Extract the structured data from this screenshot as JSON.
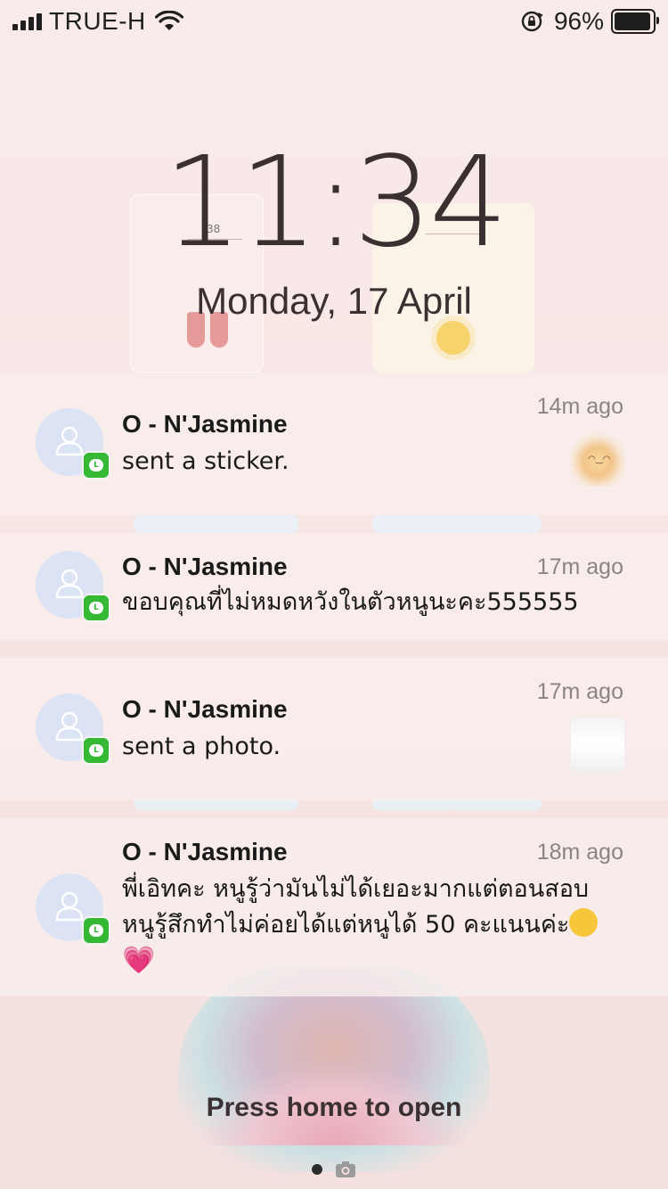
{
  "status_bar": {
    "carrier": "TRUE-H",
    "battery_percent": "96%",
    "battery_level": 0.96,
    "signal_icon": "signal-bars-icon",
    "wifi_icon": "wifi-icon",
    "orientation_lock_icon": "orientation-lock-icon",
    "battery_icon": "battery-icon"
  },
  "lock_screen": {
    "time": "11:34",
    "date": "Monday, 17 April",
    "press_home": "Press home to open"
  },
  "wallpaper": {
    "calendar_number": "38"
  },
  "notifications": [
    {
      "sender": "O - N'Jasmine",
      "time": "14m ago",
      "message": "sent a sticker.",
      "app_badge_letter": "L",
      "thumbnail": "sticker"
    },
    {
      "sender": "O - N'Jasmine",
      "time": "17m ago",
      "message": "ขอบคุณที่ไม่หมดหวังในตัวหนูนะคะ555555",
      "app_badge_letter": "L"
    },
    {
      "sender": "O - N'Jasmine",
      "time": "17m ago",
      "message": "sent a photo.",
      "app_badge_letter": "L",
      "thumbnail": "photo"
    },
    {
      "sender": "O - N'Jasmine",
      "time": "18m ago",
      "message_line1": "พี่เอิทคะ หนูรู้ว่ามันไม่ได้เยอะมากแต่ตอนสอบ",
      "message_line2": "หนูรู้สึกทำไม่ค่อยได้แต่หนูได้ 50 คะแนนค่ะ",
      "message_emoji": "🥹",
      "message_line3": "💗",
      "app_badge_letter": "L"
    }
  ],
  "colors": {
    "background": "#f7e6e6",
    "clock_text": "#3a2f31",
    "line_green": "#35b935",
    "avatar_bg": "#dbe3f5"
  }
}
